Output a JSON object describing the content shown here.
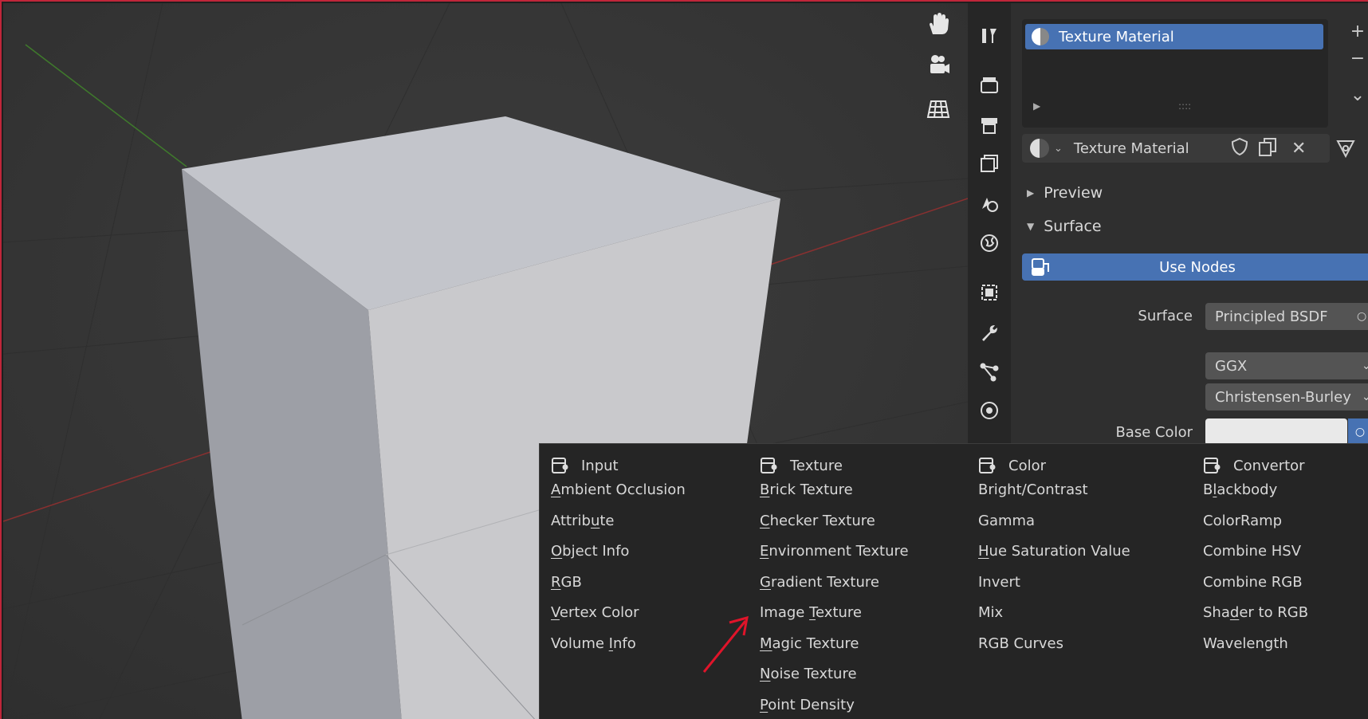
{
  "viewport": {
    "nav_icons": [
      "hand-pan-icon",
      "camera-icon",
      "grid-icon"
    ]
  },
  "properties": {
    "material_slot": "Texture Material",
    "material_name": "Texture Material",
    "panels": {
      "preview": "Preview",
      "surface": "Surface"
    },
    "use_nodes_label": "Use Nodes",
    "surface_label": "Surface",
    "surface_value": "Principled BSDF",
    "distribution_value": "GGX",
    "subsurface_value": "Christensen-Burley",
    "base_color_label": "Base Color",
    "accent": "#4772b3"
  },
  "tabs": [
    "tool-icon",
    "render-icon",
    "output-icon",
    "view-layer-icon",
    "scene-icon",
    "world-icon",
    "object-icon",
    "modifier-icon",
    "particles-icon",
    "physics-icon"
  ],
  "add_menu": {
    "columns": [
      {
        "title": "Input",
        "items": [
          {
            "pre": "",
            "u": "A",
            "post": "mbient Occlusion"
          },
          {
            "pre": "Attrib",
            "u": "u",
            "post": "te"
          },
          {
            "pre": "",
            "u": "O",
            "post": "bject Info"
          },
          {
            "pre": "",
            "u": "R",
            "post": "GB"
          },
          {
            "pre": "",
            "u": "V",
            "post": "ertex Color"
          },
          {
            "pre": "Volume ",
            "u": "I",
            "post": "nfo"
          }
        ]
      },
      {
        "title": "Texture",
        "items": [
          {
            "pre": "",
            "u": "B",
            "post": "rick Texture"
          },
          {
            "pre": "",
            "u": "C",
            "post": "hecker Texture"
          },
          {
            "pre": "",
            "u": "E",
            "post": "nvironment Texture"
          },
          {
            "pre": "",
            "u": "G",
            "post": "radient Texture"
          },
          {
            "pre": "Image ",
            "u": "T",
            "post": "exture"
          },
          {
            "pre": "",
            "u": "M",
            "post": "agic Texture"
          },
          {
            "pre": "",
            "u": "N",
            "post": "oise Texture"
          },
          {
            "pre": "",
            "u": "P",
            "post": "oint Density"
          }
        ]
      },
      {
        "title": "Color",
        "items": [
          {
            "pre": "Bright/Contrast",
            "u": "",
            "post": ""
          },
          {
            "pre": "Gamma",
            "u": "",
            "post": ""
          },
          {
            "pre": "",
            "u": "H",
            "post": "ue Saturation Value"
          },
          {
            "pre": "Invert",
            "u": "",
            "post": ""
          },
          {
            "pre": "Mix",
            "u": "",
            "post": ""
          },
          {
            "pre": "RGB Curves",
            "u": "",
            "post": ""
          }
        ]
      },
      {
        "title": "Convertor",
        "items": [
          {
            "pre": "B",
            "u": "l",
            "post": "ackbody"
          },
          {
            "pre": "ColorRamp",
            "u": "",
            "post": ""
          },
          {
            "pre": "Combine HSV",
            "u": "",
            "post": ""
          },
          {
            "pre": "Combine RGB",
            "u": "",
            "post": ""
          },
          {
            "pre": "Sha",
            "u": "d",
            "post": "er to RGB"
          },
          {
            "pre": "Wavelength",
            "u": "",
            "post": ""
          }
        ]
      }
    ]
  }
}
